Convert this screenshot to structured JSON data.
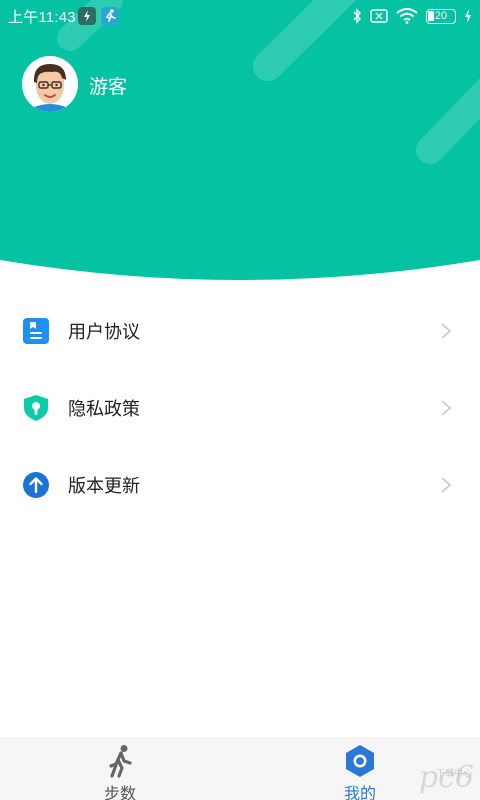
{
  "colors": {
    "header_bg": "#05c3a2",
    "accent_blue": "#2a79d6",
    "agreement_icon": "#1f8ff0",
    "privacy_icon": "#0ccba8",
    "update_icon": "#1c73d6"
  },
  "status_bar": {
    "time": "上午11:43",
    "battery_level": "20",
    "icons": [
      "app-notification-icon",
      "running-app-icon",
      "bluetooth-icon",
      "sim-none-icon",
      "wifi-icon",
      "battery-icon",
      "charging-icon"
    ]
  },
  "profile": {
    "avatar_icon": "cartoon-face-avatar",
    "username": "游客"
  },
  "menu": {
    "items": [
      {
        "label": "用户协议",
        "icon": "document-icon"
      },
      {
        "label": "隐私政策",
        "icon": "shield-key-icon"
      },
      {
        "label": "版本更新",
        "icon": "arrow-up-circle-icon"
      }
    ]
  },
  "tabbar": {
    "tabs": [
      {
        "label": "步数",
        "icon": "walking-person-icon",
        "active": false
      },
      {
        "label": "我的",
        "icon": "hexagon-profile-icon",
        "active": true
      }
    ]
  },
  "watermark": {
    "brand_sub": "下载中心"
  }
}
